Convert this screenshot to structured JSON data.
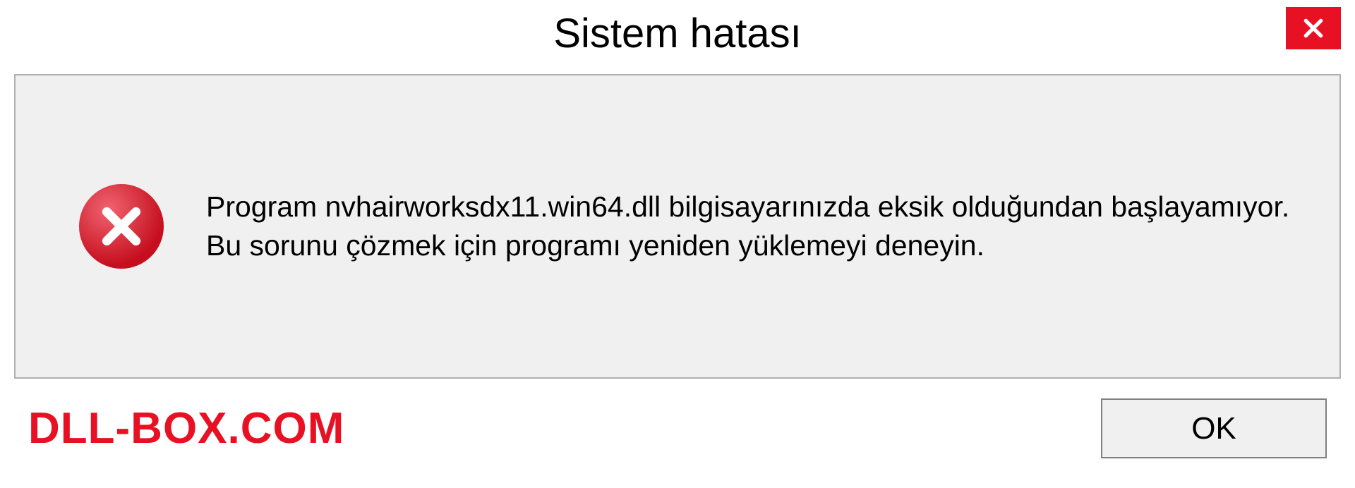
{
  "dialog": {
    "title": "Sistem hatası",
    "message": "Program nvhairworksdx11.win64.dll bilgisayarınızda eksik olduğundan başlayamıyor. Bu sorunu çözmek için programı yeniden yüklemeyi deneyin.",
    "ok_label": "OK"
  },
  "watermark": "DLL-BOX.COM"
}
